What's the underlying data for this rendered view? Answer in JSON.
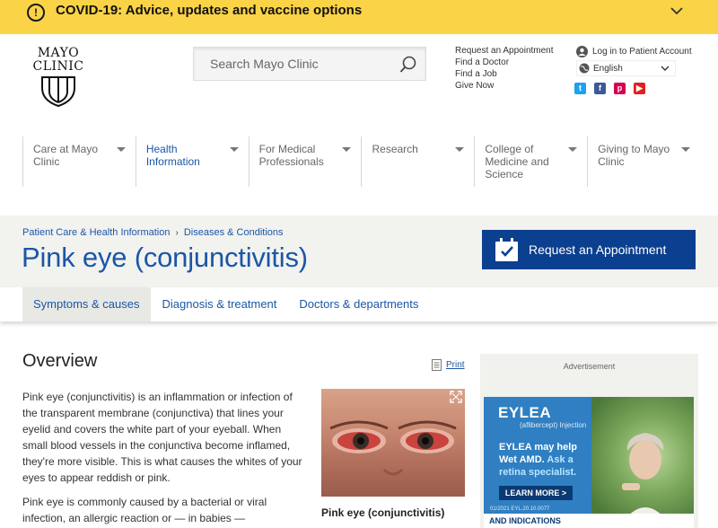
{
  "banner": {
    "text": "COVID-19: Advice, updates and vaccine options",
    "icon": "exclamation-circle-icon"
  },
  "logo": {
    "line1": "MAYO",
    "line2": "CLINIC"
  },
  "search": {
    "placeholder": "Search Mayo Clinic"
  },
  "utility_links": [
    "Request an Appointment",
    "Find a Doctor",
    "Find a Job",
    "Give Now"
  ],
  "account": {
    "login": "Log in to Patient Account",
    "language": "English"
  },
  "social": [
    {
      "name": "twitter-icon",
      "glyph": "t",
      "color": "#1da1f2"
    },
    {
      "name": "facebook-icon",
      "glyph": "f",
      "color": "#3b5998"
    },
    {
      "name": "pinterest-icon",
      "glyph": "p",
      "color": "#d6004e"
    },
    {
      "name": "youtube-icon",
      "glyph": "▶",
      "color": "#e02020"
    }
  ],
  "nav": [
    {
      "label": "Care at Mayo Clinic",
      "active": false
    },
    {
      "label": "Health Information",
      "active": true
    },
    {
      "label": "For Medical Professionals",
      "active": false
    },
    {
      "label": "Research",
      "active": false
    },
    {
      "label": "College of Medicine and Science",
      "active": false
    },
    {
      "label": "Giving to Mayo Clinic",
      "active": false
    }
  ],
  "breadcrumbs": [
    "Patient Care & Health Information",
    "Diseases & Conditions"
  ],
  "page_title": "Pink eye (conjunctivitis)",
  "appointment_button": "Request an Appointment",
  "tabs": [
    {
      "label": "Symptoms & causes",
      "active": true
    },
    {
      "label": "Diagnosis & treatment",
      "active": false
    },
    {
      "label": "Doctors & departments",
      "active": false
    }
  ],
  "content": {
    "heading": "Overview",
    "print": "Print",
    "paragraph1": "Pink eye (conjunctivitis) is an inflammation or infection of the transparent membrane (conjunctiva) that lines your eyelid and covers the white part of your eyeball. When small blood vessels in the conjunctiva become inflamed, they're more visible. This is what causes the whites of your eyes to appear reddish or pink.",
    "paragraph2": "Pink eye is commonly caused by a bacterial or viral infection, an allergic reaction or — in babies —",
    "image_caption": "Pink eye (conjunctivitis)"
  },
  "ad": {
    "label": "Advertisement",
    "brand": "EYLEA",
    "brand_sub": "(aflibercept) Injection",
    "headline": "EYLEA may help Wet AMD.",
    "headline_highlight": "Ask a retina specialist.",
    "cta": "LEARN MORE >",
    "code": "01/2021 EYL.20.10.0077",
    "footer": "AND INDICATIONS"
  },
  "colors": {
    "banner": "#fbd347",
    "brand_blue": "#1a57a6",
    "appointment": "#0b3f8f"
  }
}
